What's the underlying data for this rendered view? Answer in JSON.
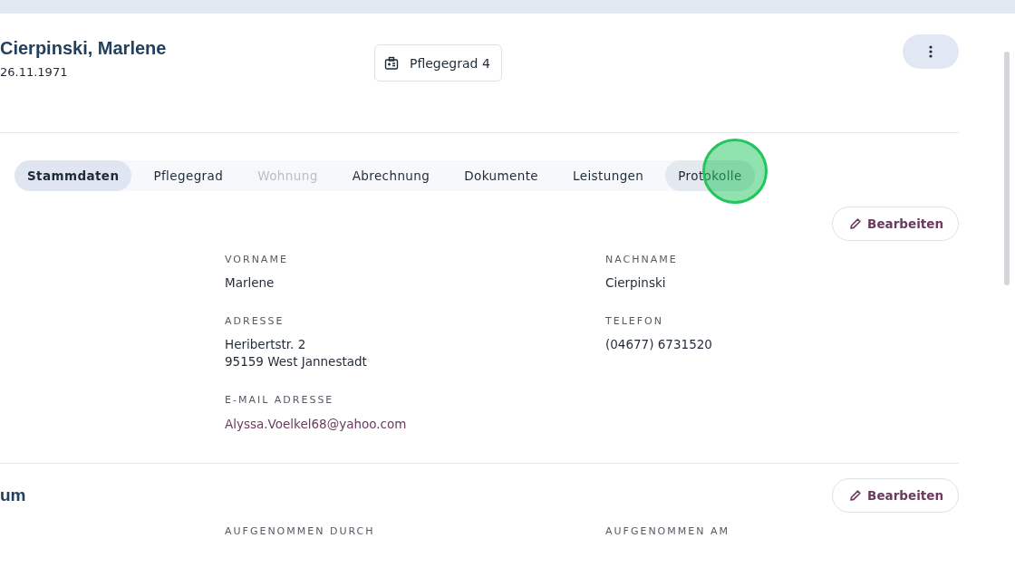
{
  "header": {
    "name": "Cierpinski, Marlene",
    "birthdate": "26.11.1971",
    "badge": "Pflegegrad 4"
  },
  "tabs": [
    {
      "label": "Stammdaten",
      "selected": true,
      "disabled": false,
      "hovered": false
    },
    {
      "label": "Pflegegrad",
      "selected": false,
      "disabled": false,
      "hovered": false
    },
    {
      "label": "Wohnung",
      "selected": false,
      "disabled": true,
      "hovered": false
    },
    {
      "label": "Abrechnung",
      "selected": false,
      "disabled": false,
      "hovered": false
    },
    {
      "label": "Dokumente",
      "selected": false,
      "disabled": false,
      "hovered": false
    },
    {
      "label": "Leistungen",
      "selected": false,
      "disabled": false,
      "hovered": false
    },
    {
      "label": "Protokolle",
      "selected": false,
      "disabled": false,
      "hovered": true
    }
  ],
  "click_indicator": {
    "on": true
  },
  "sections": [
    {
      "edit_button": "Bearbeiten",
      "fields": [
        {
          "label": "VORNAME",
          "lines": [
            "Marlene"
          ],
          "kind": "text"
        },
        {
          "label": "NACHNAME",
          "lines": [
            "Cierpinski"
          ],
          "kind": "text"
        },
        {
          "label": "ADRESSE",
          "lines": [
            "Heribertstr. 2",
            "95159 West Jannestadt"
          ],
          "kind": "text"
        },
        {
          "label": "TELEFON",
          "lines": [
            "(04677) 6731520"
          ],
          "kind": "text"
        },
        {
          "label": "E-MAIL ADRESSE",
          "lines": [
            "Alyssa.Voelkel68@yahoo.com"
          ],
          "kind": "link"
        }
      ]
    },
    {
      "title": "um",
      "edit_button": "Bearbeiten",
      "fields": [
        {
          "label": "AUFGENOMMEN DURCH"
        },
        {
          "label": "AUFGENOMMEN AM"
        }
      ]
    }
  ]
}
